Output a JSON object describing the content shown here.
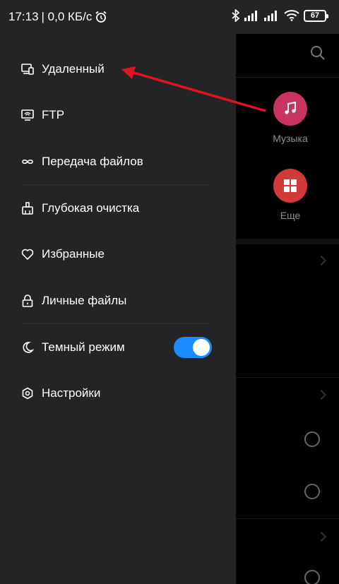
{
  "status_bar": {
    "time": "17:13",
    "network_speed": "| 0,0 КБ/с",
    "battery": "67"
  },
  "background": {
    "categories": [
      {
        "label": "Музыка",
        "color": "#c8335f",
        "icon": "music-note-icon"
      },
      {
        "label": "Еще",
        "color": "#d23a3a",
        "icon": "grid-icon"
      }
    ]
  },
  "drawer": {
    "items": [
      {
        "label": "Удаленный",
        "icon": "remote-device-icon"
      },
      {
        "label": "FTP",
        "icon": "ftp-icon"
      },
      {
        "label": "Передача файлов",
        "icon": "transfer-loop-icon"
      },
      {
        "label": "Глубокая очистка",
        "icon": "brush-icon"
      },
      {
        "label": "Избранные",
        "icon": "heart-icon"
      },
      {
        "label": "Личные файлы",
        "icon": "lock-icon"
      },
      {
        "label": "Темный режим",
        "icon": "moon-icon"
      },
      {
        "label": "Настройки",
        "icon": "gear-icon"
      }
    ],
    "dark_mode_enabled": true
  },
  "colors": {
    "drawer_bg": "#242426",
    "toggle_on": "#1a8cff",
    "annotation_arrow": "#e0141e"
  }
}
